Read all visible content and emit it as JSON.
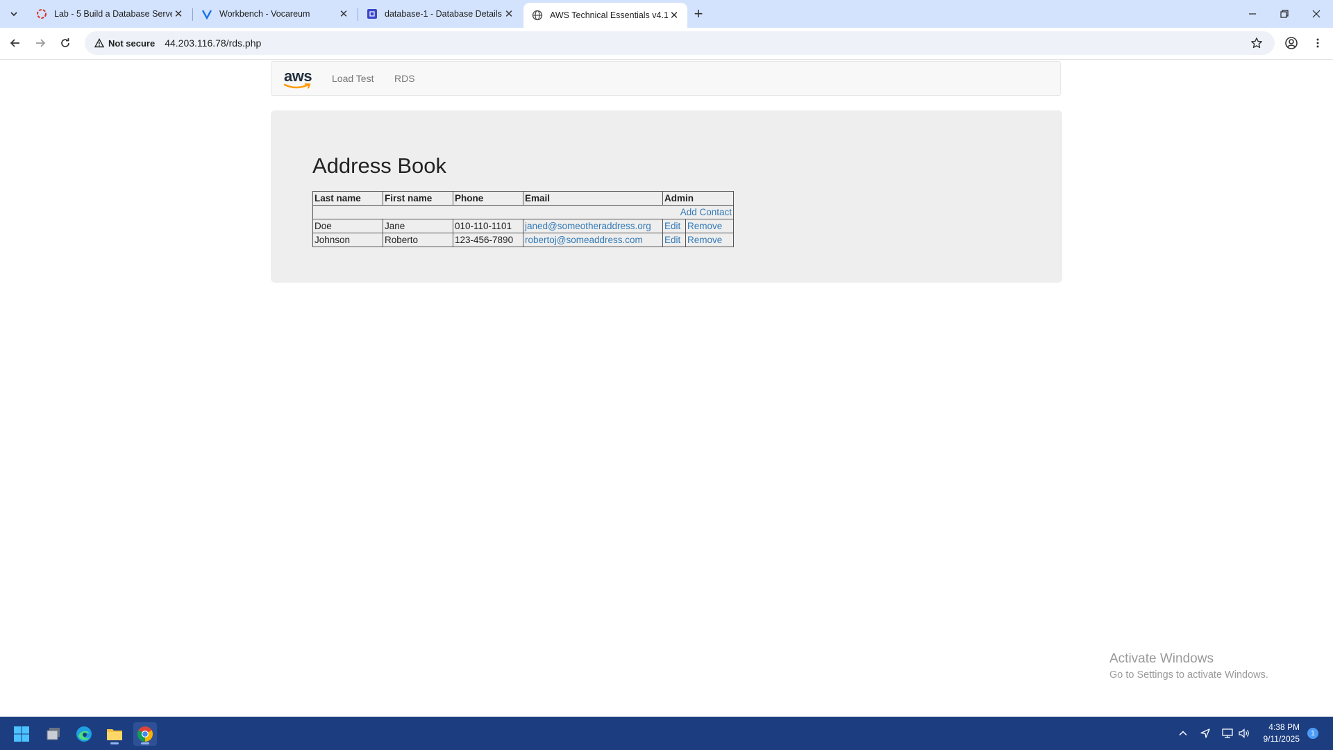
{
  "browser": {
    "tabs": [
      {
        "title": "Lab - 5 Build a Database Server",
        "icon": "lab-icon",
        "active": false
      },
      {
        "title": "Workbench - Vocareum",
        "icon": "vocareum-icon",
        "active": false
      },
      {
        "title": "database-1 - Database Details |",
        "icon": "rds-icon",
        "active": false
      },
      {
        "title": "AWS Technical Essentials v4.1",
        "icon": "globe-icon",
        "active": true
      }
    ],
    "security_label": "Not secure",
    "url": "44.203.116.78/rds.php"
  },
  "site": {
    "logo_text": "aws",
    "nav": [
      "Load Test",
      "RDS"
    ]
  },
  "address_book": {
    "heading": "Address Book",
    "columns": [
      "Last name",
      "First name",
      "Phone",
      "Email",
      "Admin"
    ],
    "add_contact_label": "Add Contact",
    "rows": [
      {
        "last": "Doe",
        "first": "Jane",
        "phone": "010-110-1101",
        "email": "janed@someotheraddress.org",
        "edit": "Edit",
        "remove": "Remove"
      },
      {
        "last": "Johnson",
        "first": "Roberto",
        "phone": "123-456-7890",
        "email": "robertoj@someaddress.com",
        "edit": "Edit",
        "remove": "Remove"
      }
    ]
  },
  "watermark": {
    "line1": "Activate Windows",
    "line2": "Go to Settings to activate Windows."
  },
  "taskbar": {
    "apps": [
      "windows-start-icon",
      "task-view-icon",
      "edge-icon",
      "file-explorer-icon",
      "chrome-icon"
    ],
    "time": "4:38 PM",
    "date": "9/11/2025",
    "notification_count": "1"
  },
  "colors": {
    "tabstrip": "#d3e3fd",
    "link": "#337ab7",
    "jumbotron": "#eeeeee",
    "taskbar": "#1c3d80"
  }
}
